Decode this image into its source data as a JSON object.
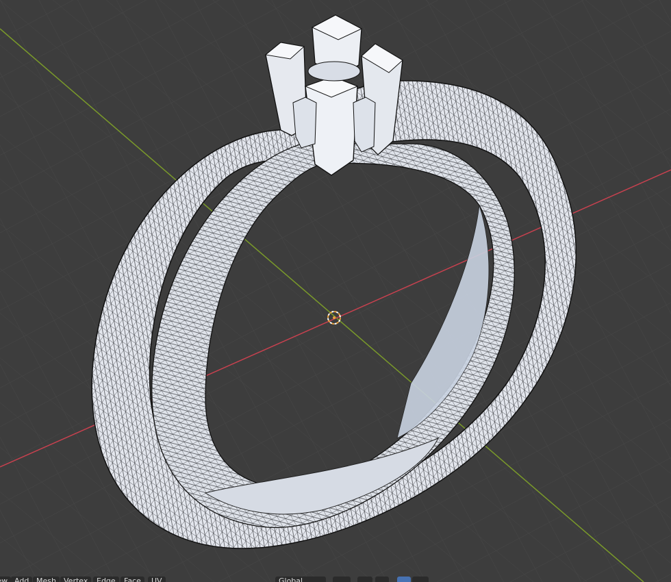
{
  "viewport": {
    "mode": "Edit Mode",
    "object": "ring mesh",
    "background_color": "#3d3d3d",
    "grid_color": "#4a4a4a",
    "x_axis_color": "#c8414f",
    "y_axis_color": "#7a9a2a",
    "mesh_face_color": "#e2e6ee",
    "wire_color": "#111111",
    "cursor_color": "#e8a03c"
  },
  "header_menu": {
    "items": [
      {
        "label": "View",
        "name": "menu-view"
      },
      {
        "label": "Add",
        "name": "menu-add"
      },
      {
        "label": "Mesh",
        "name": "menu-mesh"
      },
      {
        "label": "Vertex",
        "name": "menu-vertex"
      },
      {
        "label": "Edge",
        "name": "menu-edge"
      },
      {
        "label": "Face",
        "name": "menu-face"
      },
      {
        "label": "UV",
        "name": "menu-uv"
      }
    ],
    "transform_orientation": "Global",
    "icons": [
      "pivot-point-icon",
      "snap-icon",
      "proportional-editing-icon",
      "overlay-icon",
      "xray-icon"
    ]
  }
}
